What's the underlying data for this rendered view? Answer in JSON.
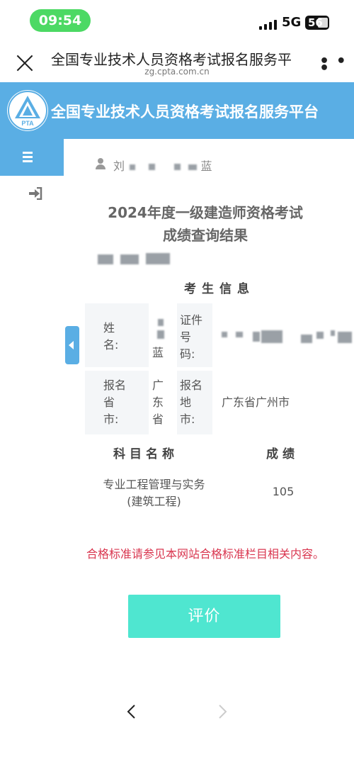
{
  "status_bar": {
    "time": "09:54",
    "network": "5G",
    "battery": "56"
  },
  "browser_header": {
    "title": "全国专业技术人员资格考试报名服务平",
    "url": "zg.cpta.com.cn"
  },
  "banner": {
    "logo_text": "PTA",
    "title": "全国专业技术人员资格考试报名服务平台"
  },
  "user": {
    "name_first": "刘",
    "name_last": "蓝"
  },
  "result": {
    "title_line1": "2024年度一级建造师资格考试",
    "title_line2": "成绩查询结果",
    "section_title": "考生信息",
    "labels": {
      "name": "姓名:",
      "id_number": "证件号码:",
      "province": "报名省市:",
      "city": "报名地市:"
    },
    "values": {
      "name_char": "蓝",
      "province": "广东省",
      "city": "广东省广州市"
    },
    "score_table": {
      "col_subject": "科目名称",
      "col_score": "成绩",
      "rows": [
        {
          "subject": "专业工程管理与实务(建筑工程)",
          "score": "105"
        }
      ]
    },
    "note": "合格标准请参见本网站合格标准栏目相关内容。",
    "evaluate_label": "评价"
  },
  "colors": {
    "banner_blue": "#5aaee4",
    "status_green": "#4cd964",
    "note_red": "#d9364f",
    "button_teal": "#4fe6d0"
  },
  "icons": [
    "close-icon",
    "more-icon",
    "menu-icon",
    "login-icon",
    "user-icon",
    "collapse-arrow-icon",
    "back-arrow-icon",
    "forward-arrow-icon"
  ]
}
